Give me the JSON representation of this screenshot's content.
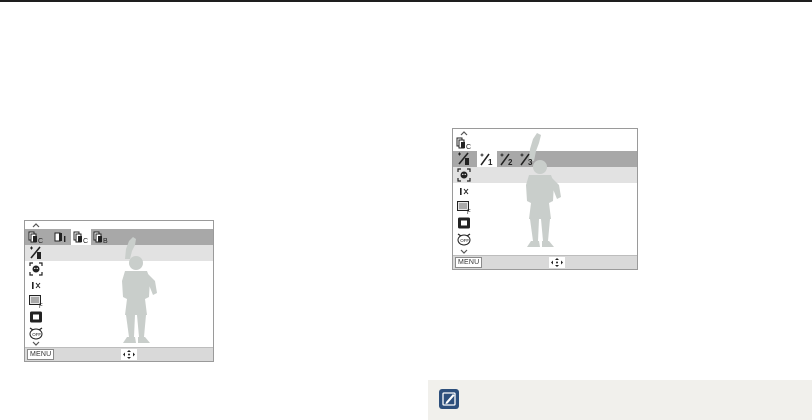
{
  "screens": [
    {
      "id": "drive-mode-screen",
      "sidebar_icons": [
        "scroll-up-icon",
        "drive-mode-icon",
        "photo-edit-icon",
        "face-detection-icon",
        "iso-icon",
        "metering-icon",
        "image-size-icon",
        "self-timer-icon",
        "scroll-down-icon"
      ],
      "options": [
        "single-shot-icon",
        "continuous-shot-icon",
        "bracket-shot-icon"
      ],
      "selected_option": "continuous-shot-icon",
      "menu_label": "MENU",
      "nav_icon": "move-arrows-icon"
    },
    {
      "id": "photo-edit-screen",
      "sidebar_icons": [
        "scroll-up-icon",
        "drive-mode-icon",
        "photo-edit-icon",
        "face-detection-icon",
        "iso-icon",
        "metering-icon",
        "image-size-icon",
        "self-timer-icon",
        "scroll-down-icon"
      ],
      "options": [
        "edit-level-1-icon",
        "edit-level-2-icon",
        "edit-level-3-icon"
      ],
      "selected_option": "edit-level-1-icon",
      "menu_label": "MENU",
      "nav_icon": "move-arrows-icon"
    }
  ],
  "note": {
    "icon": "note-pencil-icon"
  },
  "colors": {
    "selected_band": "#a8a8a8",
    "light_band": "#e2e2e2",
    "bottom_bar": "#d9d9d9",
    "note_bg": "#f1f0ec",
    "top_rule": "#1e1e1e"
  }
}
